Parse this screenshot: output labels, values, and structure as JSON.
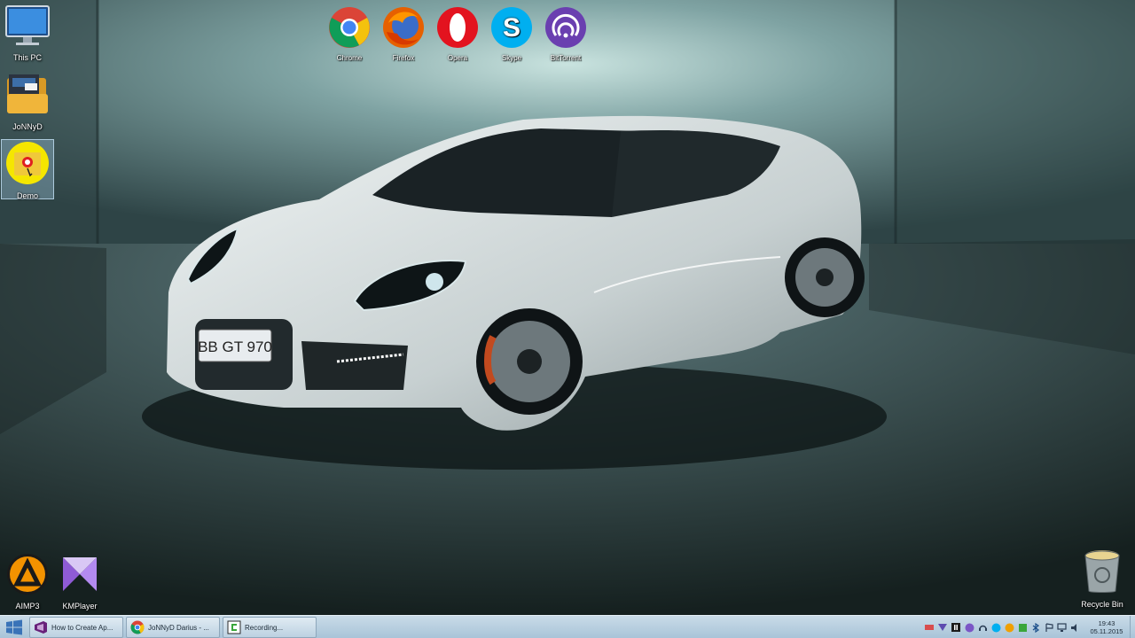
{
  "desktop": {
    "left_icons": [
      {
        "name": "this-pc",
        "label": "This PC"
      },
      {
        "name": "jonnyd-folder",
        "label": "JoNNyD"
      },
      {
        "name": "demo-folder",
        "label": "Demo"
      }
    ],
    "top_icons": [
      {
        "name": "chrome",
        "label": "Chrome"
      },
      {
        "name": "firefox",
        "label": "Firefox"
      },
      {
        "name": "opera",
        "label": "Opera"
      },
      {
        "name": "skype",
        "label": "Skype"
      },
      {
        "name": "bittorrent",
        "label": "BitTorrent"
      }
    ],
    "bottom_icons": [
      {
        "name": "aimp3",
        "label": "AIMP3"
      },
      {
        "name": "kmplayer",
        "label": "KMPlayer"
      }
    ],
    "recycle_bin": {
      "label": "Recycle Bin"
    },
    "wallpaper": {
      "plate_text": "BB GT 970"
    }
  },
  "taskbar": {
    "buttons": [
      {
        "icon": "visual-studio-icon",
        "label": "How to Create Ap..."
      },
      {
        "icon": "chrome-icon",
        "label": "JoNNyD Darius - ..."
      },
      {
        "icon": "camtasia-icon",
        "label": "Recording..."
      }
    ],
    "clock": {
      "time": "19:43",
      "date": "05.11.2015"
    }
  },
  "colors": {
    "taskbar_bg": "#b7cfe0",
    "accent": "#8ab4d6",
    "wall": "#7fa3a3"
  }
}
